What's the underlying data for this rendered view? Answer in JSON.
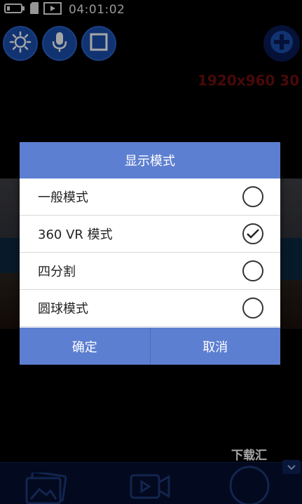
{
  "status": {
    "time": "04:01:02"
  },
  "toolbar": {
    "resolution": "1920x960 30"
  },
  "dialog": {
    "title": "显示模式",
    "options": [
      {
        "label": "一般模式",
        "selected": false
      },
      {
        "label": "360 VR 模式",
        "selected": true
      },
      {
        "label": "四分割",
        "selected": false
      },
      {
        "label": "圆球模式",
        "selected": false
      }
    ],
    "confirm_label": "确定",
    "cancel_label": "取消"
  },
  "watermark": "下载汇",
  "icons": {
    "status": [
      "battery-icon",
      "sd-card-icon",
      "video-icon"
    ],
    "toolbar": [
      "brightness-icon",
      "microphone-icon",
      "stop-icon",
      "add-icon"
    ],
    "bottom": [
      "gallery-icon",
      "video-camera-icon",
      "shutter-icon",
      "chevron-down-icon"
    ]
  },
  "colors": {
    "accent": "#5d7fd1",
    "toolbar_button": "#1b4fb0",
    "resolution_text": "#6f0f0f"
  }
}
